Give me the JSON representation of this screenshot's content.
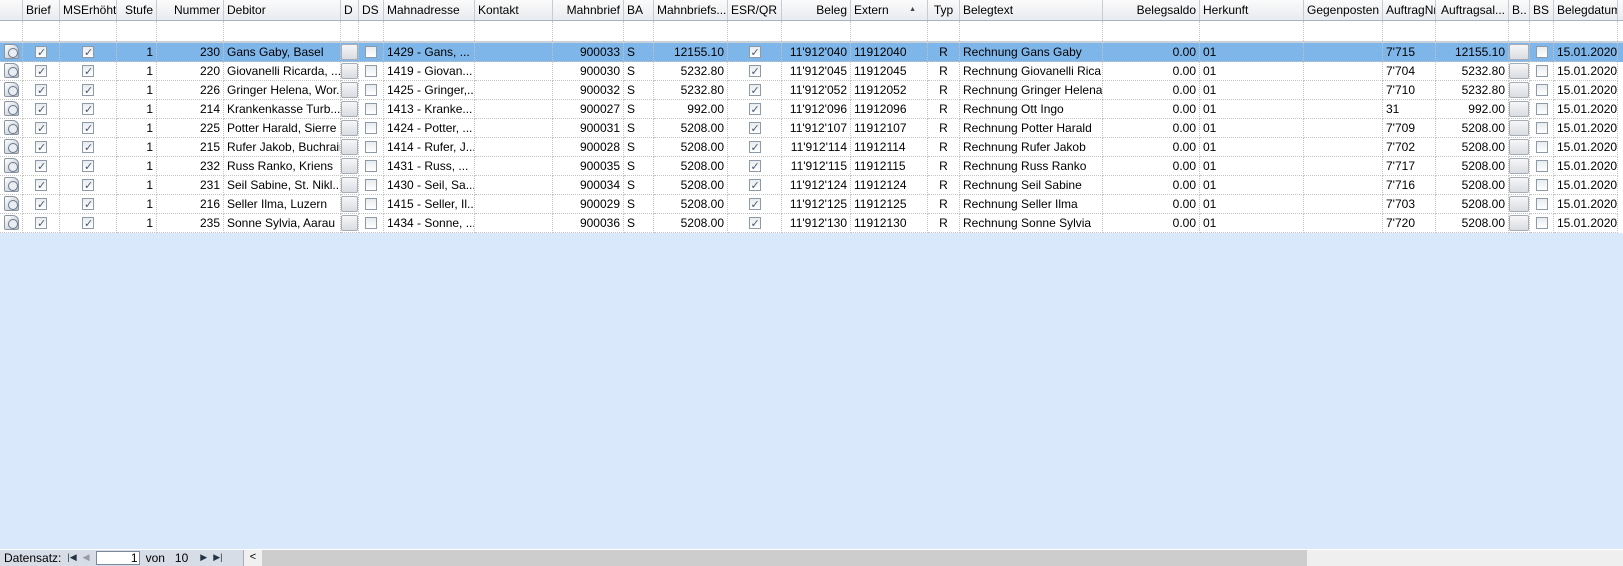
{
  "columns": [
    {
      "key": "icon",
      "label": "",
      "type": "icon"
    },
    {
      "key": "brief",
      "label": "Brief",
      "type": "check"
    },
    {
      "key": "mserhoeht",
      "label": "MSErhöht",
      "type": "check"
    },
    {
      "key": "stufe",
      "label": "Stufe",
      "type": "text",
      "align": "r"
    },
    {
      "key": "nummer",
      "label": "Nummer",
      "type": "text",
      "align": "r"
    },
    {
      "key": "debitor",
      "label": "Debitor",
      "type": "text"
    },
    {
      "key": "d",
      "label": "D",
      "type": "button"
    },
    {
      "key": "ds",
      "label": "DS",
      "type": "check"
    },
    {
      "key": "mahnadresse",
      "label": "Mahnadresse",
      "type": "text"
    },
    {
      "key": "kontakt",
      "label": "Kontakt",
      "type": "text"
    },
    {
      "key": "mahnbrief",
      "label": "Mahnbrief",
      "type": "text",
      "align": "r"
    },
    {
      "key": "ba",
      "label": "BA",
      "type": "text"
    },
    {
      "key": "mahnbriefsaldo",
      "label": "Mahnbriefs...",
      "type": "text",
      "align": "r"
    },
    {
      "key": "esrqr",
      "label": "ESR/QR",
      "type": "check"
    },
    {
      "key": "beleg",
      "label": "Beleg",
      "type": "text",
      "align": "r"
    },
    {
      "key": "extern",
      "label": "Extern",
      "type": "text",
      "sort": "▲"
    },
    {
      "key": "typ",
      "label": "Typ",
      "type": "text",
      "align": "ctr"
    },
    {
      "key": "belegtext",
      "label": "Belegtext",
      "type": "text"
    },
    {
      "key": "belegsaldo",
      "label": "Belegsaldo",
      "type": "text",
      "align": "r"
    },
    {
      "key": "herkunft",
      "label": "Herkunft",
      "type": "text"
    },
    {
      "key": "gegenposten",
      "label": "Gegenposten",
      "type": "text"
    },
    {
      "key": "auftragnr",
      "label": "AuftragNr",
      "type": "text"
    },
    {
      "key": "auftragsaldo",
      "label": "Auftragsal...",
      "type": "text",
      "align": "r"
    },
    {
      "key": "b",
      "label": "B..",
      "type": "button"
    },
    {
      "key": "bs",
      "label": "BS",
      "type": "check"
    },
    {
      "key": "belegdatum",
      "label": "Belegdatum",
      "type": "text"
    }
  ],
  "rows": [
    [
      "",
      true,
      true,
      "1",
      "230",
      "Gans Gaby, Basel",
      "",
      false,
      "1429 - Gans, ...",
      "",
      "900033",
      "S",
      "12155.10",
      true,
      "11'912'040",
      "11912040",
      "R",
      "Rechnung Gans Gaby",
      "0.00",
      "01",
      "",
      "7'715",
      "12155.10",
      "",
      false,
      "15.01.2020"
    ],
    [
      "",
      true,
      true,
      "1",
      "220",
      "Giovanelli Ricarda, ...",
      "",
      false,
      "1419 - Giovan...",
      "",
      "900030",
      "S",
      "5232.80",
      true,
      "11'912'045",
      "11912045",
      "R",
      "Rechnung Giovanelli Rica...",
      "0.00",
      "01",
      "",
      "7'704",
      "5232.80",
      "",
      false,
      "15.01.2020"
    ],
    [
      "",
      true,
      true,
      "1",
      "226",
      "Gringer Helena, Wor...",
      "",
      false,
      "1425 - Gringer,...",
      "",
      "900032",
      "S",
      "5232.80",
      true,
      "11'912'052",
      "11912052",
      "R",
      "Rechnung Gringer Helena",
      "0.00",
      "01",
      "",
      "7'710",
      "5232.80",
      "",
      false,
      "15.01.2020"
    ],
    [
      "",
      true,
      true,
      "1",
      "214",
      "Krankenkasse Turb...",
      "",
      false,
      "1413 - Kranke...",
      "",
      "900027",
      "S",
      "992.00",
      true,
      "11'912'096",
      "11912096",
      "R",
      "Rechnung Ott Ingo",
      "0.00",
      "01",
      "",
      "31",
      "992.00",
      "",
      false,
      "15.01.2020"
    ],
    [
      "",
      true,
      true,
      "1",
      "225",
      "Potter Harald, Sierre",
      "",
      false,
      "1424 - Potter, ...",
      "",
      "900031",
      "S",
      "5208.00",
      true,
      "11'912'107",
      "11912107",
      "R",
      "Rechnung Potter Harald",
      "0.00",
      "01",
      "",
      "7'709",
      "5208.00",
      "",
      false,
      "15.01.2020"
    ],
    [
      "",
      true,
      true,
      "1",
      "215",
      "Rufer Jakob, Buchrain",
      "",
      false,
      "1414 - Rufer, J...",
      "",
      "900028",
      "S",
      "5208.00",
      true,
      "11'912'114",
      "11912114",
      "R",
      "Rechnung Rufer Jakob",
      "0.00",
      "01",
      "",
      "7'702",
      "5208.00",
      "",
      false,
      "15.01.2020"
    ],
    [
      "",
      true,
      true,
      "1",
      "232",
      "Russ Ranko, Kriens",
      "",
      false,
      "1431 - Russ, ...",
      "",
      "900035",
      "S",
      "5208.00",
      true,
      "11'912'115",
      "11912115",
      "R",
      "Rechnung Russ Ranko",
      "0.00",
      "01",
      "",
      "7'717",
      "5208.00",
      "",
      false,
      "15.01.2020"
    ],
    [
      "",
      true,
      true,
      "1",
      "231",
      "Seil Sabine, St. Nikl...",
      "",
      false,
      "1430 - Seil, Sa...",
      "",
      "900034",
      "S",
      "5208.00",
      true,
      "11'912'124",
      "11912124",
      "R",
      "Rechnung Seil Sabine",
      "0.00",
      "01",
      "",
      "7'716",
      "5208.00",
      "",
      false,
      "15.01.2020"
    ],
    [
      "",
      true,
      true,
      "1",
      "216",
      "Seller Ilma, Luzern",
      "",
      false,
      "1415 - Seller, Il...",
      "",
      "900029",
      "S",
      "5208.00",
      true,
      "11'912'125",
      "11912125",
      "R",
      "Rechnung Seller Ilma",
      "0.00",
      "01",
      "",
      "7'703",
      "5208.00",
      "",
      false,
      "15.01.2020"
    ],
    [
      "",
      true,
      true,
      "1",
      "235",
      "Sonne Sylvia, Aarau",
      "",
      false,
      "1434 - Sonne, ...",
      "",
      "900036",
      "S",
      "5208.00",
      true,
      "11'912'130",
      "11912130",
      "R",
      "Rechnung Sonne Sylvia",
      "0.00",
      "01",
      "",
      "7'720",
      "5208.00",
      "",
      false,
      "15.01.2020"
    ]
  ],
  "selected_row": 0,
  "navigator": {
    "label": "Datensatz:",
    "current": "1",
    "of_label": "von",
    "total": "10"
  },
  "colors": {
    "selection": "#7fb6ea",
    "background": "#d9e8fa"
  }
}
